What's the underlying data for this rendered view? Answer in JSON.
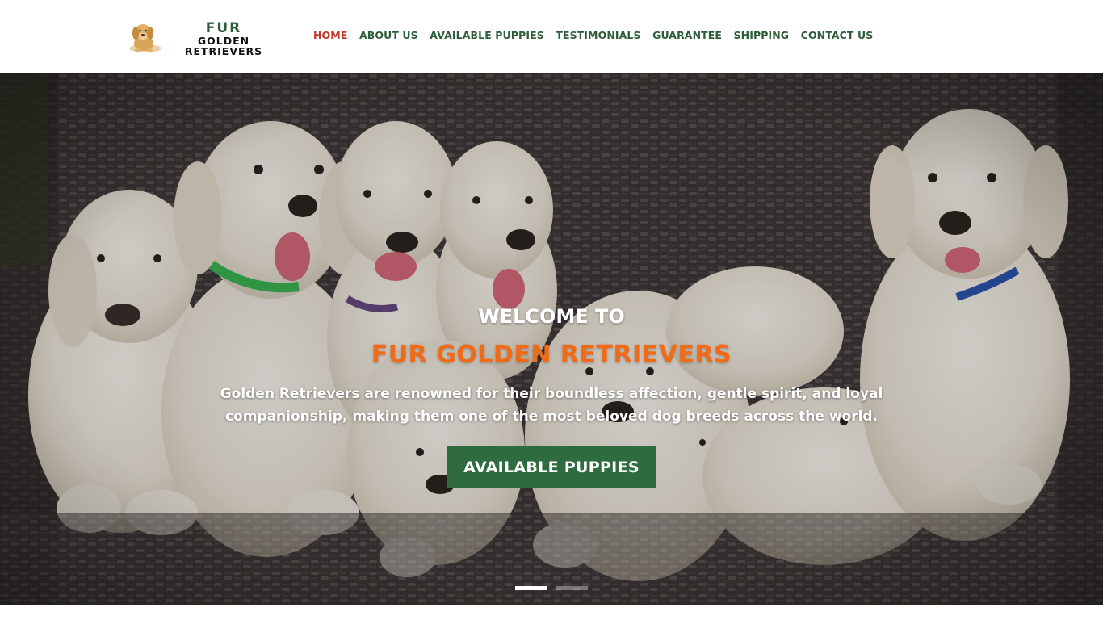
{
  "logo": {
    "line1": "FUR",
    "line2": "GOLDEN RETRIEVERS",
    "icon": "golden-retriever-puppy-icon"
  },
  "nav": {
    "items": [
      {
        "label": "HOME",
        "active": true
      },
      {
        "label": "ABOUT US",
        "active": false
      },
      {
        "label": "AVAILABLE PUPPIES",
        "active": false
      },
      {
        "label": "TESTIMONIALS",
        "active": false
      },
      {
        "label": "GUARANTEE",
        "active": false
      },
      {
        "label": "SHIPPING",
        "active": false
      },
      {
        "label": "CONTACT US",
        "active": false
      }
    ]
  },
  "hero": {
    "welcome": "WELCOME TO",
    "brand": "FUR GOLDEN RETRIEVERS",
    "tagline": "Golden Retrievers are renowned for their boundless affection, gentle spirit, and loyal companionship, making them one of the most beloved dog breeds across the world.",
    "cta_label": "AVAILABLE PUPPIES",
    "slides_total": 2,
    "slide_active": 1
  },
  "colors": {
    "nav_text": "#2f5d3a",
    "nav_active": "#c0392b",
    "brand_orange": "#f26a16",
    "cta_green": "#2e6b3e"
  }
}
